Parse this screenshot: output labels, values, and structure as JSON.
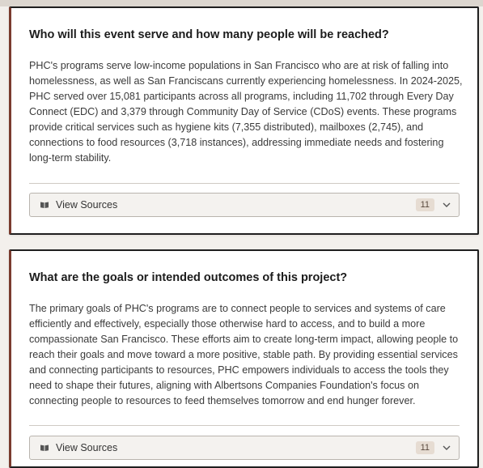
{
  "sections": [
    {
      "question": "Who will this event serve and how many people will be reached?",
      "answer": "PHC's programs serve low-income populations in San Francisco who are at risk of falling into homelessness, as well as San Franciscans currently experiencing homelessness. In 2024-2025, PHC served over 15,081 participants across all programs, including 11,702 through Every Day Connect (EDC) and 3,379 through Community Day of Service (CDoS) events. These programs provide critical services such as hygiene kits (7,355 distributed), mailboxes (2,745), and connections to food resources (3,718 instances), addressing immediate needs and fostering long-term stability.",
      "sources_label": "View Sources",
      "sources_count": "11",
      "icon": "book-icon"
    },
    {
      "question": "What are the goals or intended outcomes of this project?",
      "answer": "The primary goals of PHC's programs are to connect people to services and systems of care efficiently and effectively, especially those otherwise hard to access, and to build a more compassionate San Francisco. These efforts aim to create long-term impact, allowing people to reach their goals and move toward a more positive, stable path. By providing essential services and connecting participants to resources, PHC empowers individuals to access the tools they need to shape their futures, aligning with Albertsons Companies Foundation's focus on connecting people to resources to feed themselves tomorrow and end hunger forever.",
      "sources_label": "View Sources",
      "sources_count": "11",
      "icon": "book-icon"
    }
  ],
  "colors": {
    "card_accent": "#7a3b2e",
    "badge_bg": "#e6dcd2",
    "button_bg": "#f4f2ef"
  }
}
